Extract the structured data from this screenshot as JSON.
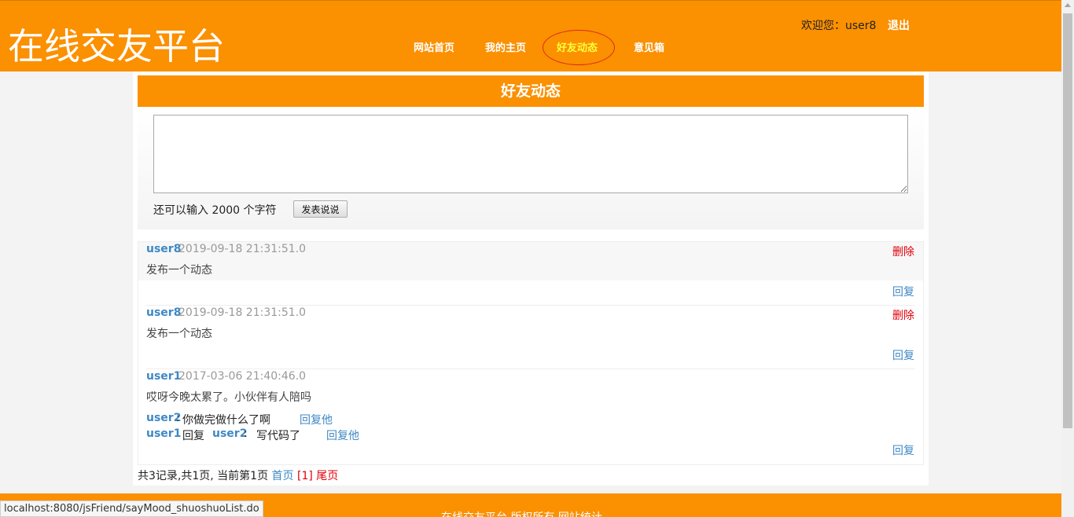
{
  "header": {
    "logo": "在线交友平台",
    "nav": [
      "网站首页",
      "我的主页",
      "好友动态",
      "意见箱"
    ],
    "welcome": "欢迎您：user8",
    "logout": "退出"
  },
  "section_title": "好友动态",
  "composer": {
    "textarea_value": "",
    "remaining": "还可以输入 2000 个字符",
    "submit": "发表说说"
  },
  "posts": [
    {
      "user": "user8",
      "time": "2019-09-18 21:31:51.0",
      "content": "发布一个动态",
      "delete": "删除",
      "reply": "回复"
    },
    {
      "user": "user8",
      "time": "2019-09-18 21:31:51.0",
      "content": "发布一个动态",
      "delete": "删除",
      "reply": "回复"
    },
    {
      "user": "user1",
      "time": "2017-03-06 21:40:46.0",
      "content": "哎呀今晚太累了。小伙伴有人陪吗",
      "reply": "回复",
      "comments": [
        {
          "user": "user2",
          "sep": ":",
          "text": "你做完做什么了啊",
          "reply": "回复他"
        },
        {
          "user": "user1",
          "verb": "回复",
          "target": "user2",
          "sep": ":",
          "text": "写代码了",
          "reply": "回复他"
        }
      ]
    }
  ],
  "pager": {
    "summary": "共3记录,共1页, 当前第1页",
    "first": "首页",
    "current": "[1]",
    "last": "尾页"
  },
  "footer": {
    "text": "在线交友平台 版权所有 网站统计"
  },
  "status_url": "localhost:8080/jsFriend/sayMood_shuoshuoList.do",
  "colors": {
    "brand": "#fb9000",
    "link": "#3f88c5",
    "danger": "#e0000b",
    "active_nav": "#ffff3c"
  }
}
